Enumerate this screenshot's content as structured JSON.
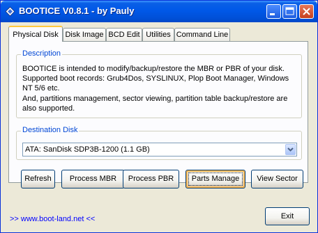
{
  "window": {
    "title": "BOOTICE V0.8.1 - by Pauly",
    "controls": [
      "minimize-icon",
      "maximize-icon",
      "close-icon"
    ]
  },
  "tabs": [
    {
      "label": "Physical Disk",
      "active": true
    },
    {
      "label": "Disk Image",
      "active": false
    },
    {
      "label": "BCD Edit",
      "active": false
    },
    {
      "label": "Utilities",
      "active": false
    },
    {
      "label": "Command Line",
      "active": false
    }
  ],
  "description": {
    "title": "Description",
    "lines": [
      "BOOTICE is intended to modify/backup/restore the MBR or PBR of your disk.",
      "Supported boot records: Grub4Dos, SYSLINUX, Plop Boot Manager, Windows",
      "NT 5/6 etc.",
      "And, partitions management, sector viewing, partition table backup/restore are",
      "also supported."
    ]
  },
  "destination": {
    "title": "Destination Disk",
    "selected": "ATA: SanDisk SDP3B-1200 (1.1 GB)"
  },
  "buttons": {
    "refresh": "Refresh",
    "process_mbr": "Process MBR",
    "process_pbr": "Process PBR",
    "parts_manage": "Parts Manage",
    "view_sector": "View Sector"
  },
  "footer": {
    "link": ">> www.boot-land.net <<",
    "exit": "Exit"
  },
  "colors": {
    "titlebar": "#0058e8",
    "group_title": "#0046d5",
    "link": "#0000ff"
  }
}
